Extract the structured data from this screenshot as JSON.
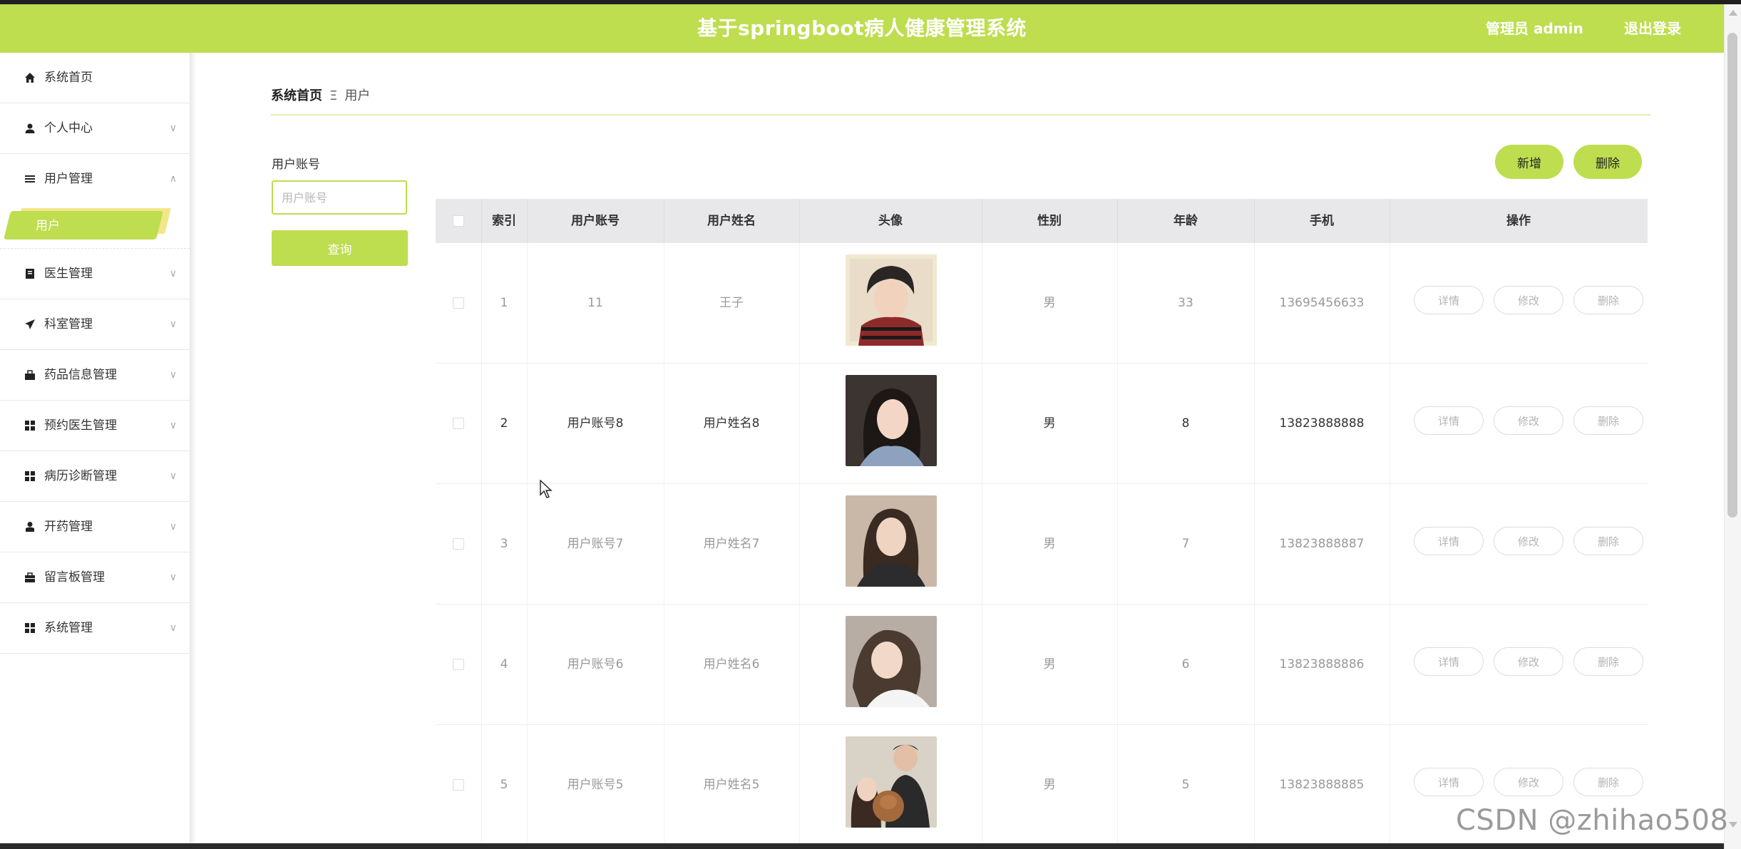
{
  "header": {
    "title": "基于springboot病人健康管理系统",
    "admin_label": "管理员 admin",
    "logout_label": "退出登录"
  },
  "colors": {
    "accent": "#bedd4f",
    "header_bg": "#bedd4f",
    "table_head_bg": "#e8e8ea"
  },
  "sidebar": {
    "items": [
      {
        "label": "系统首页",
        "icon": "home-icon",
        "has_chevron": false
      },
      {
        "label": "个人中心",
        "icon": "user-icon",
        "has_chevron": true,
        "expanded": false
      },
      {
        "label": "用户管理",
        "icon": "list-icon",
        "has_chevron": true,
        "expanded": true
      },
      {
        "label": "医生管理",
        "icon": "book-icon",
        "has_chevron": true,
        "expanded": false
      },
      {
        "label": "科室管理",
        "icon": "send-icon",
        "has_chevron": true,
        "expanded": false
      },
      {
        "label": "药品信息管理",
        "icon": "bag-icon",
        "has_chevron": true,
        "expanded": false
      },
      {
        "label": "预约医生管理",
        "icon": "grid-icon",
        "has_chevron": true,
        "expanded": false
      },
      {
        "label": "病历诊断管理",
        "icon": "grid-icon",
        "has_chevron": true,
        "expanded": false
      },
      {
        "label": "开药管理",
        "icon": "person-icon",
        "has_chevron": true,
        "expanded": false
      },
      {
        "label": "留言板管理",
        "icon": "briefcase-icon",
        "has_chevron": true,
        "expanded": false
      },
      {
        "label": "系统管理",
        "icon": "grid-icon",
        "has_chevron": true,
        "expanded": false
      }
    ],
    "sub_item": {
      "label": "用户",
      "active": true
    }
  },
  "breadcrumb": {
    "home": "系统首页",
    "separator": "Ξ",
    "current": "用户"
  },
  "search": {
    "label": "用户账号",
    "placeholder": "用户账号",
    "value": "",
    "query_label": "查询"
  },
  "actions": {
    "add_label": "新增",
    "delete_label": "删除"
  },
  "table": {
    "headers": [
      "索引",
      "用户账号",
      "用户姓名",
      "头像",
      "性别",
      "年龄",
      "手机",
      "操作"
    ],
    "row_actions": {
      "detail": "详情",
      "edit": "修改",
      "delete": "删除"
    },
    "rows": [
      {
        "index": "1",
        "account": "11",
        "name": "王子",
        "gender": "男",
        "age": "33",
        "phone": "13695456633",
        "avatar": "photo-young-man-striped-shirt"
      },
      {
        "index": "2",
        "account": "用户账号8",
        "name": "用户姓名8",
        "gender": "男",
        "age": "8",
        "phone": "13823888888",
        "avatar": "photo-woman-long-hair"
      },
      {
        "index": "3",
        "account": "用户账号7",
        "name": "用户姓名7",
        "gender": "男",
        "age": "7",
        "phone": "13823888887",
        "avatar": "photo-woman-blazer"
      },
      {
        "index": "4",
        "account": "用户账号6",
        "name": "用户姓名6",
        "gender": "男",
        "age": "6",
        "phone": "13823888886",
        "avatar": "photo-woman-white-shirt"
      },
      {
        "index": "5",
        "account": "用户账号5",
        "name": "用户姓名5",
        "gender": "男",
        "age": "5",
        "phone": "13823888885",
        "avatar": "photo-couple-with-dog"
      }
    ]
  },
  "watermark": "CSDN @zhihao508"
}
